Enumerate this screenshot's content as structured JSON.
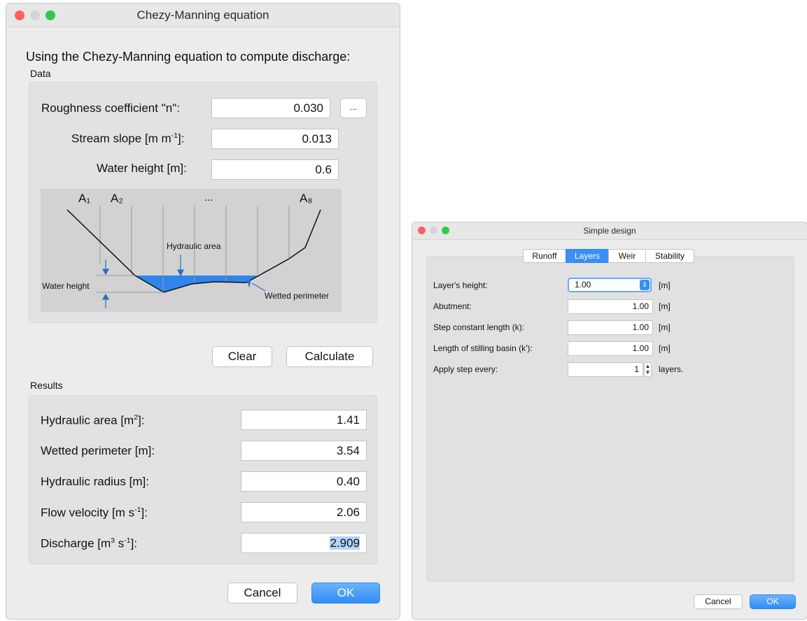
{
  "window1": {
    "title": "Chezy-Manning equation",
    "heading": "Using the Chezy-Manning equation to compute discharge:",
    "data_label": "Data",
    "roughness": {
      "label": "Roughness coefficient \"n\":",
      "value": "0.030",
      "more_label": "..."
    },
    "slope": {
      "label_pre": "Stream slope [m m",
      "label_sup": "-1",
      "label_post": "]:",
      "value": "0.013"
    },
    "water_height": {
      "label": "Water height [m]:",
      "value": "0.6"
    },
    "diagram": {
      "a1": "A₁",
      "a2": "A₂",
      "dots": "...",
      "a8": "A₈",
      "hydraulic_area": "Hydraulic area",
      "water_height": "Water height",
      "wetted_perimeter": "Wetted perimeter"
    },
    "clear_label": "Clear",
    "calculate_label": "Calculate",
    "results_label": "Results",
    "results": [
      {
        "label_pre": "Hydraulic area [m",
        "sup": "2",
        "label_post": "]:",
        "value": "1.41"
      },
      {
        "label_pre": "Wetted perimeter [m]:",
        "sup": "",
        "label_post": "",
        "value": "3.54"
      },
      {
        "label_pre": "Hydraulic radius [m]:",
        "sup": "",
        "label_post": "",
        "value": "0.40"
      },
      {
        "label_pre": "Flow velocity [m s",
        "sup": "-1",
        "label_post": "]:",
        "value": "2.06"
      },
      {
        "label_pre": "Discharge [m",
        "sup": "3",
        "label_mid": " s",
        "sup2": "-1",
        "label_post": "]:",
        "value": "2.909"
      }
    ],
    "cancel_label": "Cancel",
    "ok_label": "OK"
  },
  "window2": {
    "title": "Simple design",
    "tabs": [
      "Runoff",
      "Layers",
      "Weir",
      "Stability"
    ],
    "active_tab": "Layers",
    "rows": [
      {
        "label": "Layer's height:",
        "value": "1.00",
        "unit": "[m]"
      },
      {
        "label": "Abutment:",
        "value": "1.00",
        "unit": "[m]"
      },
      {
        "label": "Step constant length (k):",
        "value": "1.00",
        "unit": "[m]"
      },
      {
        "label": "Length of stilling basin (k'):",
        "value": "1.00",
        "unit": "[m]"
      },
      {
        "label": "Apply step every:",
        "value": "1",
        "unit": "layers."
      }
    ],
    "cancel_label": "Cancel",
    "ok_label": "OK"
  },
  "colors": {
    "traffic_red": "#fc605c",
    "traffic_yellow": "#fdbc40",
    "traffic_green": "#34c84a",
    "inactive_light": "#d5d5d5",
    "accent": "#3a8ff6",
    "water": "#2f85ee",
    "selection": "#b3d4fc"
  }
}
